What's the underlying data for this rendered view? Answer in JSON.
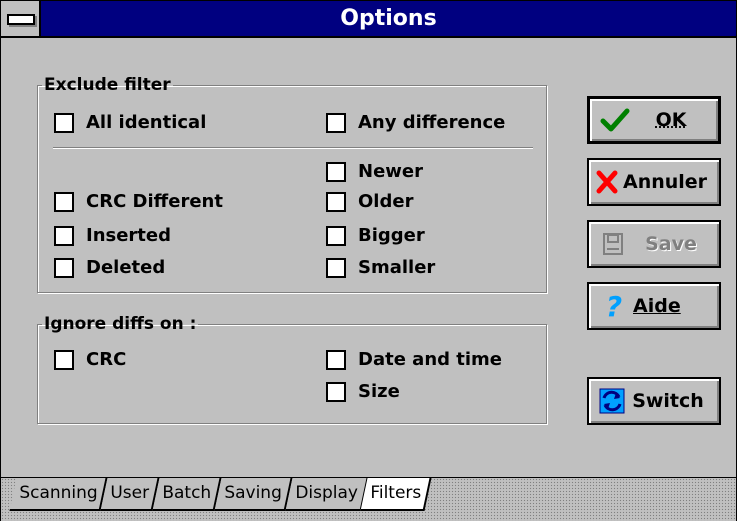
{
  "window": {
    "title": "Options"
  },
  "exclude_filter": {
    "legend": "Exclude filter",
    "all_identical": "All identical",
    "any_difference": "Any difference",
    "newer": "Newer",
    "crc_different": "CRC Different",
    "older": "Older",
    "inserted": "Inserted",
    "bigger": "Bigger",
    "deleted": "Deleted",
    "smaller": "Smaller"
  },
  "ignore_diffs": {
    "legend": "Ignore diffs on :",
    "crc": "CRC",
    "date_and_time": "Date and time",
    "size": "Size"
  },
  "buttons": {
    "ok": "OK",
    "cancel": "Annuler",
    "save": "Save",
    "help": "Aide",
    "switch": "Switch"
  },
  "tabs": [
    "Scanning",
    "User",
    "Batch",
    "Saving",
    "Display",
    "Filters"
  ],
  "active_tab": "Filters",
  "icons": {
    "system_menu": "minus-bar-icon",
    "ok": "checkmark-icon",
    "cancel": "red-x-icon",
    "save": "floppy-disk-icon",
    "help": "question-mark-icon",
    "switch": "swap-arrows-icon"
  },
  "colors": {
    "titlebar": "#000080",
    "face": "#c0c0c0",
    "ok_check": "#008000",
    "cancel_x": "#ff0000",
    "help_q": "#00a0ff"
  }
}
